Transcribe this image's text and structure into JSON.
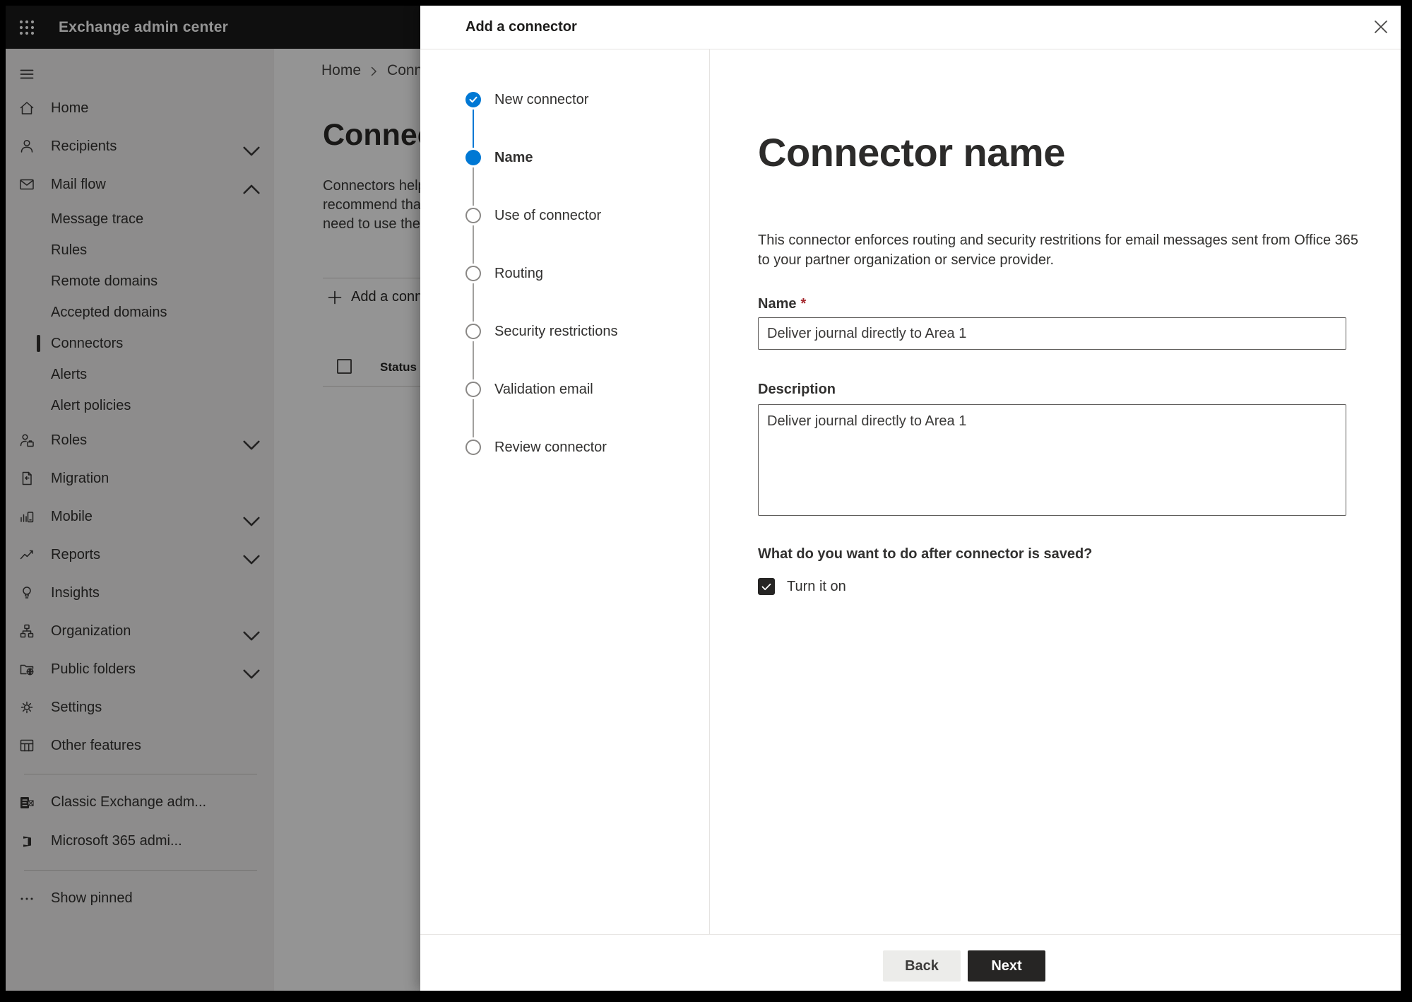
{
  "topbar": {
    "title": "Exchange admin center"
  },
  "sidebar": {
    "items": [
      {
        "label": "Home"
      },
      {
        "label": "Recipients"
      },
      {
        "label": "Mail flow"
      },
      {
        "label": "Message trace"
      },
      {
        "label": "Rules"
      },
      {
        "label": "Remote domains"
      },
      {
        "label": "Accepted domains"
      },
      {
        "label": "Connectors",
        "selected": true
      },
      {
        "label": "Alerts"
      },
      {
        "label": "Alert policies"
      },
      {
        "label": "Roles"
      },
      {
        "label": "Migration"
      },
      {
        "label": "Mobile"
      },
      {
        "label": "Reports"
      },
      {
        "label": "Insights"
      },
      {
        "label": "Organization"
      },
      {
        "label": "Public folders"
      },
      {
        "label": "Settings"
      },
      {
        "label": "Other features"
      },
      {
        "label": "Classic Exchange adm..."
      },
      {
        "label": "Microsoft 365 admi..."
      },
      {
        "label": "Show pinned"
      }
    ]
  },
  "page_behind": {
    "breadcrumb": {
      "home": "Home",
      "current": "Conne"
    },
    "title": "Connec",
    "description_lines": [
      "Connectors help",
      "recommend that",
      "need to use ther"
    ],
    "add_button": "Add a conn",
    "column_header": "Status"
  },
  "dialog": {
    "title": "Add a connector",
    "steps": [
      {
        "label": "New connector",
        "state": "completed"
      },
      {
        "label": "Name",
        "state": "active"
      },
      {
        "label": "Use of connector",
        "state": "upcoming"
      },
      {
        "label": "Routing",
        "state": "upcoming"
      },
      {
        "label": "Security restrictions",
        "state": "upcoming"
      },
      {
        "label": "Validation email",
        "state": "upcoming"
      },
      {
        "label": "Review connector",
        "state": "upcoming"
      }
    ],
    "form": {
      "heading": "Connector name",
      "intro_line1": "This connector enforces routing and security restritions for email messages sent from Office 365",
      "intro_line2": "to your partner organization or service provider.",
      "name_label": "Name",
      "required_mark": "*",
      "name_value": "Deliver journal directly to Area 1",
      "description_label": "Description",
      "description_value": "Deliver journal directly to Area 1",
      "after_save_question": "What do you want to do after connector is saved?",
      "turn_on_label": "Turn it on",
      "turn_on_checked": true
    },
    "footer": {
      "back_label": "Back",
      "next_label": "Next"
    }
  },
  "colors": {
    "accent_blue": "#0078d4",
    "required_red": "#a4262c",
    "topbar_black": "#1a1a1a"
  }
}
